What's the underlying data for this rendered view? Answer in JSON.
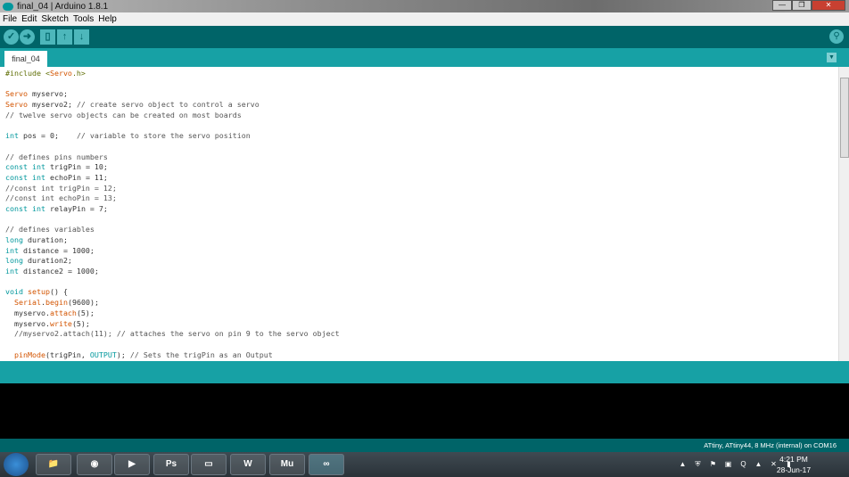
{
  "window": {
    "title": "final_04 | Arduino 1.8.1"
  },
  "menu": [
    "File",
    "Edit",
    "Sketch",
    "Tools",
    "Help"
  ],
  "toolbar": [
    {
      "name": "verify",
      "icon": "checkmark-icon",
      "glyph": "✓"
    },
    {
      "name": "upload",
      "icon": "arrow-right-icon",
      "glyph": "➜"
    },
    {
      "name": "new",
      "icon": "new-file-icon",
      "glyph": "▯"
    },
    {
      "name": "open",
      "icon": "arrow-up-icon",
      "glyph": "↑"
    },
    {
      "name": "save",
      "icon": "arrow-down-icon",
      "glyph": "↓"
    }
  ],
  "serial_monitor_icon": "magnifier-icon",
  "tab": {
    "label": "final_04"
  },
  "colors": {
    "toolbar": "#006468",
    "tabbar": "#17a1a5",
    "keyword": "#00979c",
    "function": "#d35400"
  },
  "code": [
    [
      [
        "#include <",
        "pp"
      ],
      [
        "Servo",
        "fn"
      ],
      [
        ".h>",
        "pp"
      ]
    ],
    [],
    [
      [
        "Servo",
        "fn"
      ],
      [
        " myservo;",
        ""
      ]
    ],
    [
      [
        "Servo",
        "fn"
      ],
      [
        " myservo2; ",
        ""
      ],
      [
        "// create servo object to control a servo",
        "cm"
      ]
    ],
    [
      [
        "// twelve servo objects can be created on most boards",
        "cm"
      ]
    ],
    [],
    [
      [
        "int",
        "kw"
      ],
      [
        " pos = 0;    ",
        ""
      ],
      [
        "// variable to store the servo position",
        "cm"
      ]
    ],
    [],
    [
      [
        "// defines pins numbers",
        "cm"
      ]
    ],
    [
      [
        "const",
        "kw"
      ],
      [
        " ",
        ""
      ],
      [
        "int",
        "kw"
      ],
      [
        " trigPin = 10;",
        ""
      ]
    ],
    [
      [
        "const",
        "kw"
      ],
      [
        " ",
        ""
      ],
      [
        "int",
        "kw"
      ],
      [
        " echoPin = 11;",
        ""
      ]
    ],
    [
      [
        "//const int trigPin = 12;",
        "cm"
      ]
    ],
    [
      [
        "//const int echoPin = 13;",
        "cm"
      ]
    ],
    [
      [
        "const",
        "kw"
      ],
      [
        " ",
        ""
      ],
      [
        "int",
        "kw"
      ],
      [
        " relayPin = 7;",
        ""
      ]
    ],
    [],
    [
      [
        "// defines variables",
        "cm"
      ]
    ],
    [
      [
        "long",
        "kw"
      ],
      [
        " duration;",
        ""
      ]
    ],
    [
      [
        "int",
        "kw"
      ],
      [
        " distance = 1000;",
        ""
      ]
    ],
    [
      [
        "long",
        "kw"
      ],
      [
        " duration2;",
        ""
      ]
    ],
    [
      [
        "int",
        "kw"
      ],
      [
        " distance2 = 1000;",
        ""
      ]
    ],
    [],
    [
      [
        "void",
        "kw"
      ],
      [
        " ",
        ""
      ],
      [
        "setup",
        "fn"
      ],
      [
        "() {",
        ""
      ]
    ],
    [
      [
        "  ",
        ""
      ],
      [
        "Serial",
        "fn"
      ],
      [
        ".",
        ""
      ],
      [
        "begin",
        "fn"
      ],
      [
        "(9600);",
        ""
      ]
    ],
    [
      [
        "  myservo.",
        ""
      ],
      [
        "attach",
        "fn"
      ],
      [
        "(5);",
        ""
      ]
    ],
    [
      [
        "  myservo.",
        ""
      ],
      [
        "write",
        "fn"
      ],
      [
        "(5);",
        ""
      ]
    ],
    [
      [
        "  //myservo2.attach(11); // attaches the servo on pin 9 to the servo object",
        "cm"
      ]
    ],
    [],
    [
      [
        "  ",
        ""
      ],
      [
        "pinMode",
        "fn"
      ],
      [
        "(trigPin, ",
        ""
      ],
      [
        "OUTPUT",
        "kw"
      ],
      [
        "); ",
        ""
      ],
      [
        "// Sets the trigPin as an Output",
        "cm"
      ]
    ]
  ],
  "status": {
    "board": "ATtiny, ATtiny44, 8 MHz (internal) on COM16"
  },
  "taskbar": {
    "apps": [
      {
        "name": "explorer",
        "glyph": "📁"
      },
      {
        "name": "chrome",
        "glyph": "◉"
      },
      {
        "name": "media-player",
        "glyph": "▶"
      },
      {
        "name": "photoshop",
        "glyph": "Ps"
      },
      {
        "name": "folder",
        "glyph": "▭"
      },
      {
        "name": "word",
        "glyph": "W"
      },
      {
        "name": "muse",
        "glyph": "Mu"
      },
      {
        "name": "arduino",
        "glyph": "∞"
      }
    ],
    "tray": [
      "▲",
      "⛨",
      "⚑",
      "▣",
      "Q",
      "▲",
      "✕",
      "▮"
    ],
    "time": "4:21 PM",
    "date": "28-Jun-17"
  }
}
